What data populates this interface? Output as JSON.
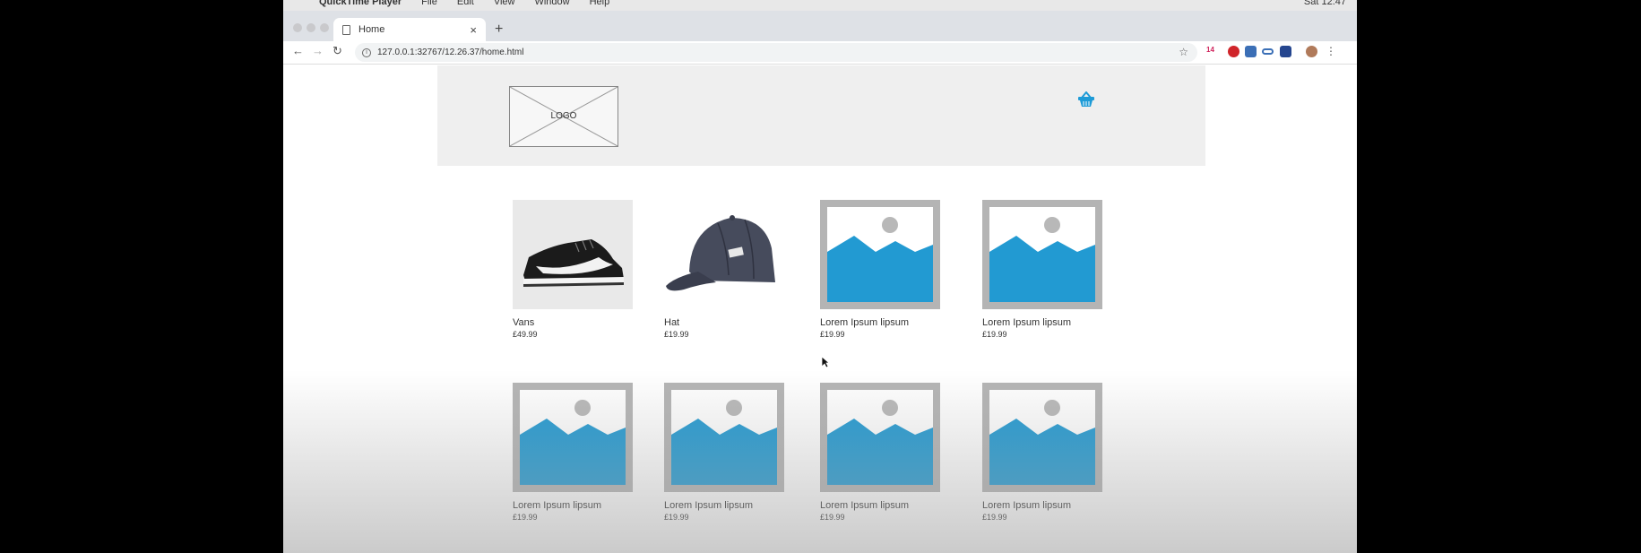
{
  "menubar": {
    "apple": "",
    "items": [
      "QuickTime Player",
      "File",
      "Edit",
      "View",
      "Window",
      "Help"
    ],
    "clock": "Sat 12:47"
  },
  "browser": {
    "tab_title": "Home",
    "tab_close": "×",
    "new_tab": "+",
    "url": "127.0.0.1:32767/12.26.37/home.html",
    "extension_badge": "14"
  },
  "site": {
    "logo_text": "LOGO",
    "basket_color": "#1e9bd7"
  },
  "products": [
    {
      "name": "Vans",
      "price": "£49.99",
      "image": "sneaker"
    },
    {
      "name": "Hat",
      "price": "£19.99",
      "image": "cap"
    },
    {
      "name": "Lorem Ipsum lipsum",
      "price": "£19.99",
      "image": "placeholder"
    },
    {
      "name": "Lorem Ipsum lipsum",
      "price": "£19.99",
      "image": "placeholder"
    },
    {
      "name": "Lorem Ipsum lipsum",
      "price": "£19.99",
      "image": "placeholder"
    },
    {
      "name": "Lorem Ipsum lipsum",
      "price": "£19.99",
      "image": "placeholder"
    },
    {
      "name": "Lorem Ipsum lipsum",
      "price": "£19.99",
      "image": "placeholder"
    },
    {
      "name": "Lorem Ipsum lipsum",
      "price": "£19.99",
      "image": "placeholder"
    }
  ],
  "colors": {
    "placeholder_frame": "#b4b4b4",
    "placeholder_sky": "#ffffff",
    "placeholder_mountain": "#229ad2",
    "placeholder_sun": "#b8b8b8"
  }
}
